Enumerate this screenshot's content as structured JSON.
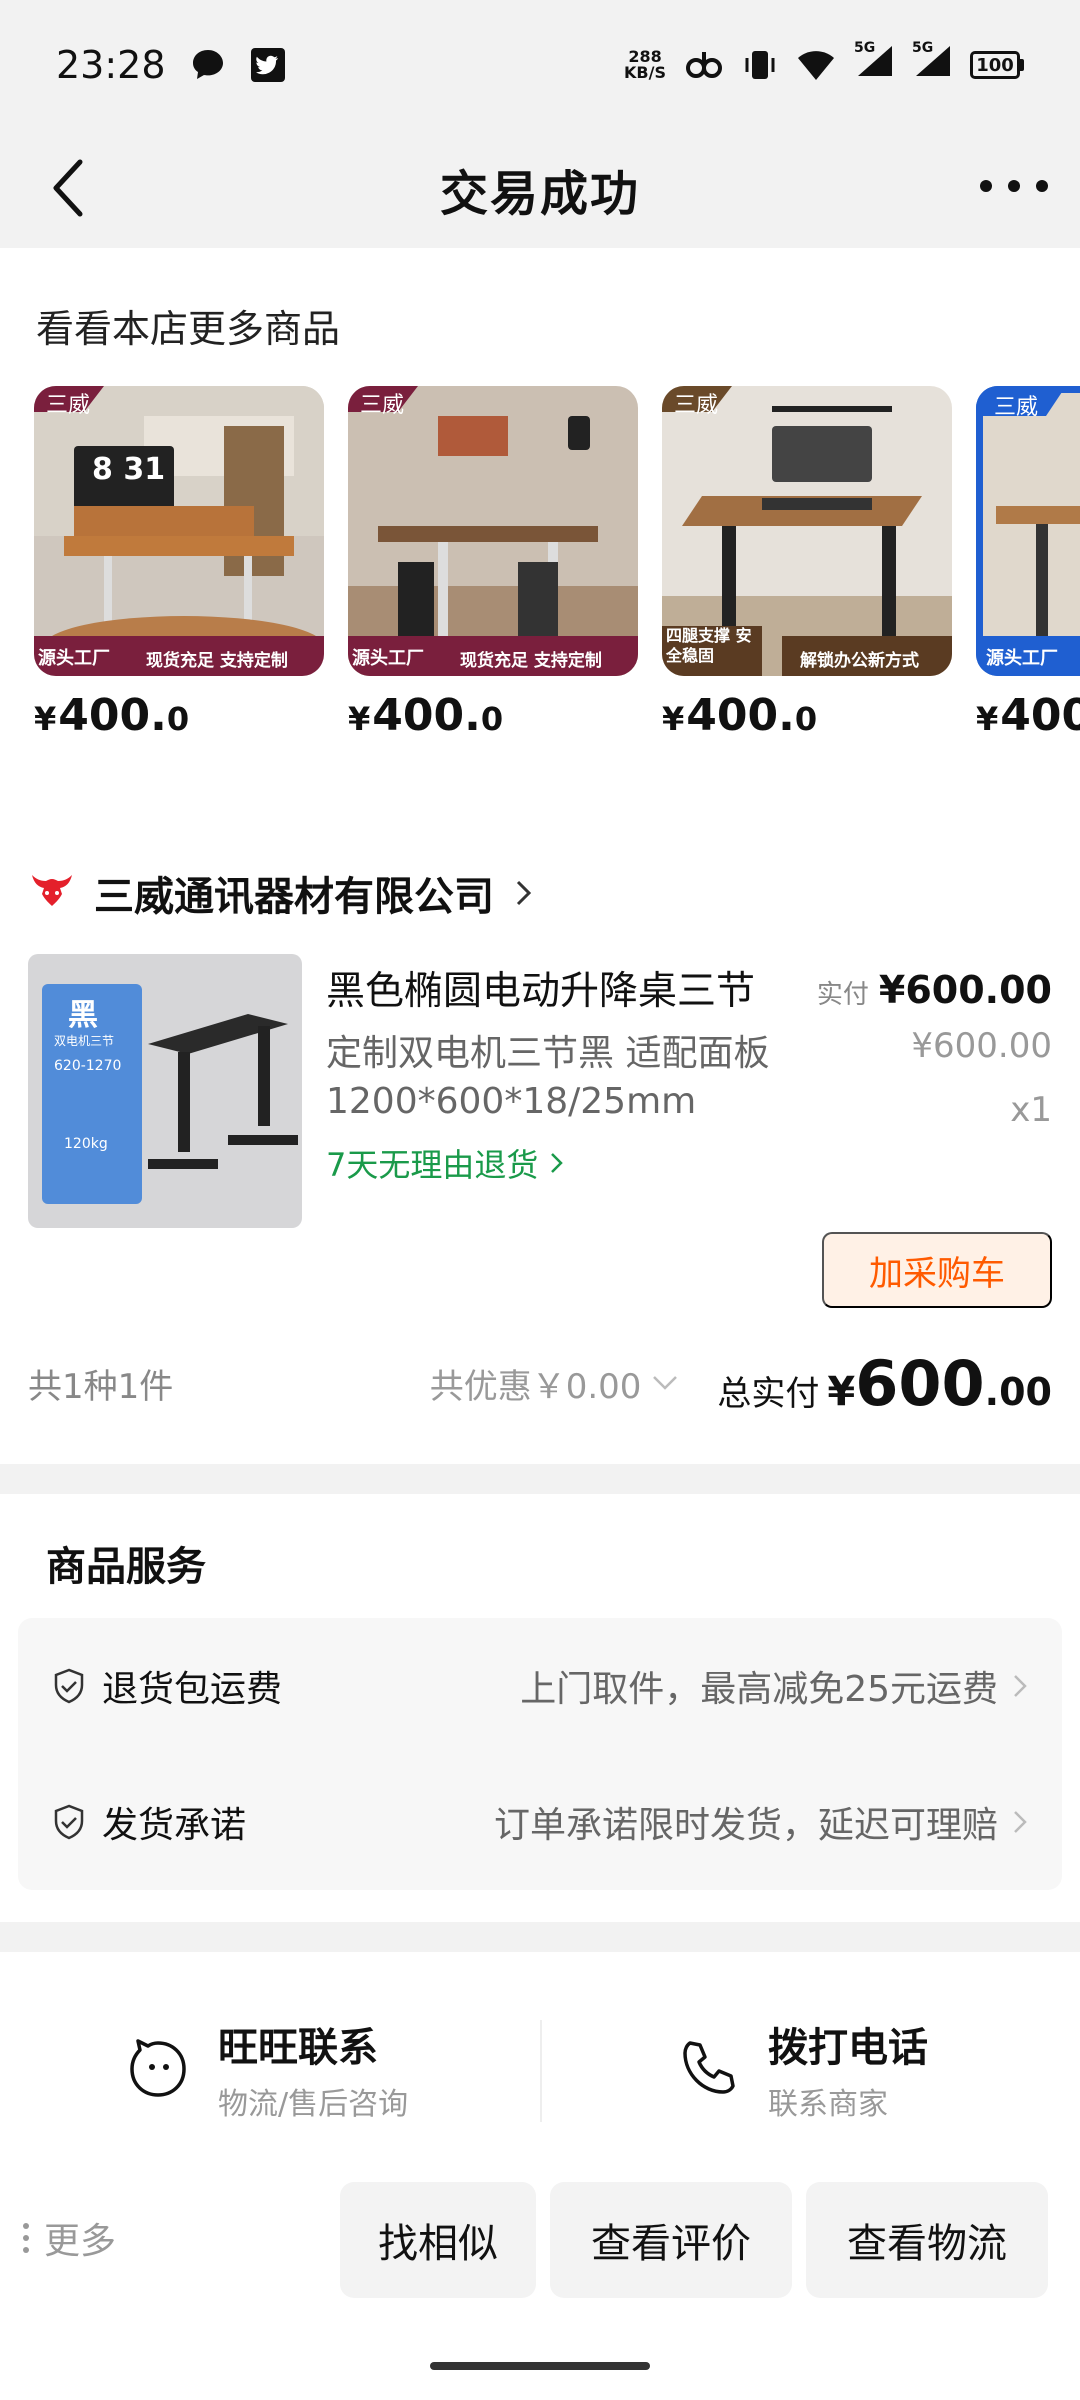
{
  "status_bar": {
    "time": "23:28",
    "net_speed_value": "288",
    "net_speed_unit": "KB/S",
    "signal_1": "5G",
    "signal_2": "5G",
    "battery": "100"
  },
  "nav": {
    "title": "交易成功"
  },
  "recommend": {
    "title": "看看本店更多商品",
    "items": [
      {
        "brand": "三威",
        "tag_left": "源头工厂",
        "tag_right": "现货充足 支持定制",
        "yen": "¥",
        "int": "400.",
        "dec": "0",
        "clock": "8 31"
      },
      {
        "brand": "三威",
        "tag_left": "源头工厂",
        "tag_right": "现货充足 支持定制",
        "yen": "¥",
        "int": "400.",
        "dec": "0"
      },
      {
        "brand": "三威",
        "tag_left": "四腿支撑 安全稳固",
        "tag_right": "解锁办公新方式",
        "yen": "¥",
        "int": "400.",
        "dec": "0"
      },
      {
        "brand": "三威",
        "tag_left": "源头工厂",
        "tag_right": "",
        "yen": "¥",
        "int": "400",
        "dec": ""
      }
    ]
  },
  "shop": {
    "name": "三威通讯器材有限公司"
  },
  "order": {
    "title": "黑色椭圆电动升降桌三节",
    "spec_line1": "定制双电机三节黑 适配面板",
    "spec_line2": "1200*600*18/25mm",
    "return_policy": "7天无理由退货",
    "paid_label": "实付",
    "paid_value": "¥600.00",
    "original_price": "¥600.00",
    "quantity": "x1",
    "add_cart_label": "加采购车",
    "thumb_badge": "黑",
    "thumb_sub": "双电机三节",
    "thumb_range": "620-1270",
    "thumb_load": "120kg"
  },
  "summary": {
    "count": "共1种1件",
    "discount": "共优惠￥0.00",
    "total_label": "总实付",
    "total_yen": "¥",
    "total_int": "600",
    "total_dec": ".00"
  },
  "services": {
    "title": "商品服务",
    "items": [
      {
        "name": "退货包运费",
        "desc": "上门取件，最高减免25元运费"
      },
      {
        "name": "发货承诺",
        "desc": "订单承诺限时发货，延迟可理赔"
      }
    ]
  },
  "contact": {
    "wangwang_title": "旺旺联系",
    "wangwang_sub": "物流/售后咨询",
    "phone_title": "拨打电话",
    "phone_sub": "联系商家"
  },
  "actions": {
    "more": "更多",
    "similar": "找相似",
    "reviews": "查看评价",
    "logistics": "查看物流"
  },
  "colors": {
    "accent_orange": "#ff5a00",
    "return_green": "#1a9a4a",
    "shop_logo_red": "#e4202b"
  }
}
